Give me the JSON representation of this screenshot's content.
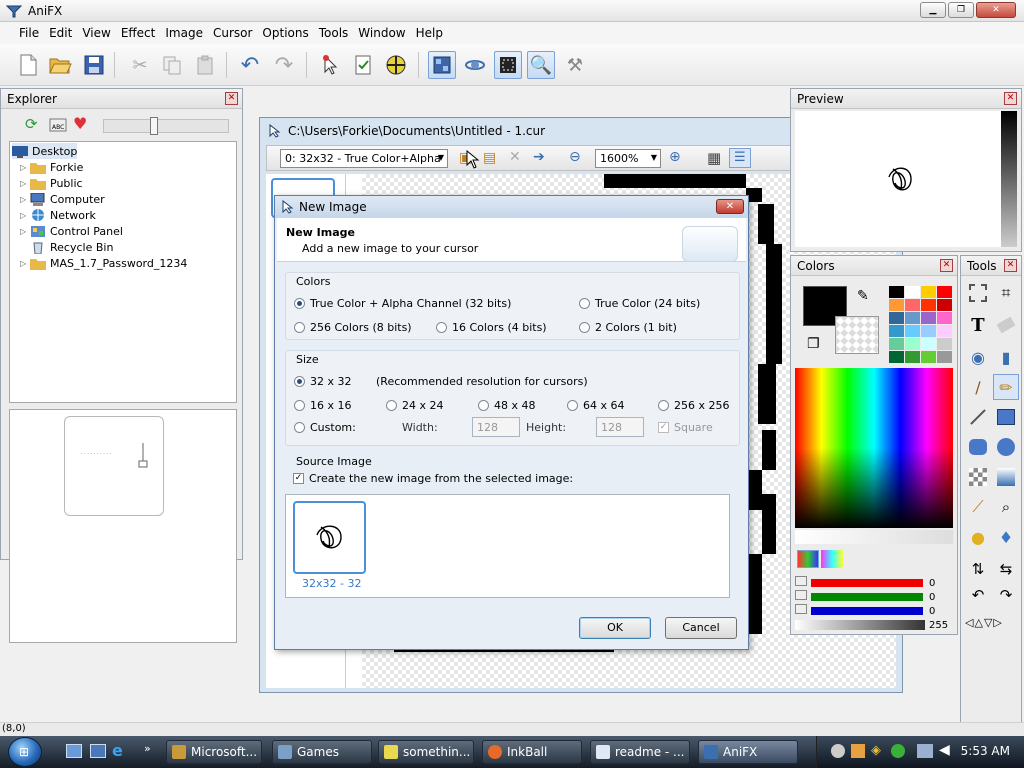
{
  "app": {
    "title": "AniFX",
    "menu": [
      "File",
      "Edit",
      "View",
      "Effect",
      "Image",
      "Cursor",
      "Options",
      "Tools",
      "Window",
      "Help"
    ]
  },
  "explorer": {
    "title": "Explorer",
    "tree": [
      "Desktop",
      "Forkie",
      "Public",
      "Computer",
      "Network",
      "Control Panel",
      "Recycle Bin",
      "MAS_1.7_Password_1234"
    ]
  },
  "document": {
    "title": "C:\\Users\\Forkie\\Documents\\Untitled - 1.cur",
    "image_select": "0: 32x32 - True Color+Alpha",
    "zoom": "1600%"
  },
  "preview": {
    "title": "Preview"
  },
  "colors": {
    "title": "Colors",
    "primary": "#000000",
    "red": "0",
    "green": "0",
    "blue": "0",
    "alpha": "255",
    "palette": [
      "#000000",
      "#ffffff",
      "#ffcc00",
      "#ff0000",
      "#ff9933",
      "#ff6666",
      "#ff3300",
      "#cc0000",
      "#336699",
      "#6699cc",
      "#9966cc",
      "#ff66cc",
      "#3399cc",
      "#66ccff",
      "#99ccff",
      "#ffccff",
      "#66cc99",
      "#99ffcc",
      "#ccffff",
      "#cccccc",
      "#006633",
      "#339933",
      "#66cc33",
      "#999999"
    ]
  },
  "tools": {
    "title": "Tools"
  },
  "dialog": {
    "title": "New Image",
    "header_title": "New Image",
    "header_subtitle": "Add a new image to your cursor",
    "colors_group": "Colors",
    "color_options": {
      "truecolor_alpha": "True Color + Alpha Channel (32 bits)",
      "truecolor": "True Color (24 bits)",
      "c256": "256 Colors (8 bits)",
      "c16": "16 Colors (4 bits)",
      "c2": "2 Colors (1 bit)"
    },
    "size_group": "Size",
    "size_options": {
      "s32": "32 x 32",
      "s32_note": "(Recommended resolution for cursors)",
      "s16": "16 x 16",
      "s24": "24 x 24",
      "s48": "48 x 48",
      "s64": "64 x 64",
      "s256": "256 x 256",
      "custom": "Custom:"
    },
    "width_label": "Width:",
    "width_value": "128",
    "height_label": "Height:",
    "height_value": "128",
    "square_label": "Square",
    "source_group": "Source Image",
    "source_checkbox": "Create the new image from the selected image:",
    "source_caption": "32x32 - 32",
    "ok_label": "OK",
    "cancel_label": "Cancel"
  },
  "status": {
    "coords": "(8,0)"
  },
  "taskbar": {
    "items": [
      "Microsoft...",
      "Games",
      "somethin...",
      "InkBall",
      "readme - ...",
      "AniFX"
    ],
    "time": "5:53 AM"
  }
}
